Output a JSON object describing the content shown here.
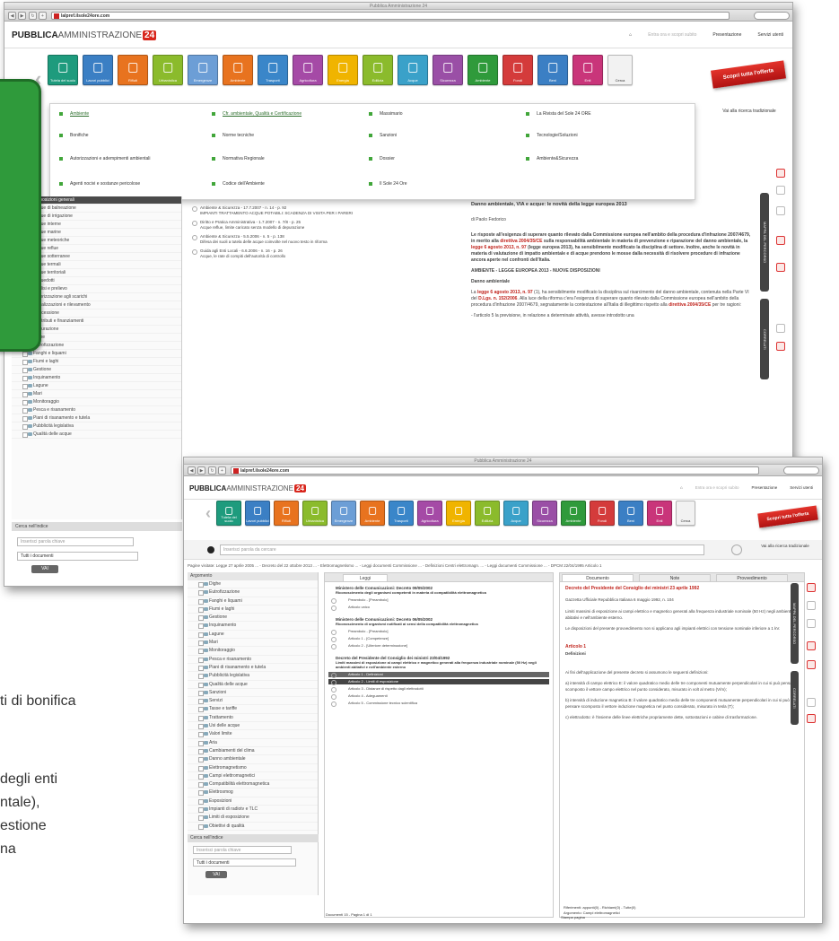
{
  "bg_text": {
    "line1": "ti di bonifica",
    "line2": "degli enti",
    "line3": "ntale),",
    "line4": "estione",
    "line5": "na"
  },
  "back_window": {
    "title": "Pubblica Amministrazione 24",
    "url_domain": "lalpref.ilsole24ore.com",
    "logo_main": "PUBBLICA",
    "logo_thin": "AMMINISTRAZIONE",
    "logo_badge": "24",
    "toplinks": [
      "Presentazione",
      "Servizi utenti"
    ],
    "toplinks_muted": "Entra ora e scopri subito",
    "ribbon": "Scopri tutta l'offerta",
    "tile_colors": [
      "#1e9b7d",
      "#3b7fc4",
      "#e8731f",
      "#8bbb2c",
      "#6c9ed6",
      "#e8731f",
      "#3a86c9",
      "#a54aa6",
      "#f0b400",
      "#8bbb2c",
      "#3aa1c9",
      "#9a4fa6",
      "#2f9a3b",
      "#d43b3b",
      "#3b7fc4",
      "#c9357a"
    ],
    "tile_labels": [
      "Tutela del suolo",
      "Lavori pubblici",
      "Rifiuti",
      "Urbanistica",
      "Emergenze",
      "Ambiente",
      "Trasporti",
      "Agricoltura",
      "Energia",
      "Edilizia",
      "Acque",
      "Sicurezza",
      "Ambiente",
      "Fondi",
      "Beni",
      "Enti"
    ],
    "extra_tile": "Cerca",
    "dropdown": {
      "col1": [
        "Ambiente",
        "Bonifiche",
        "Autorizzazioni e adempimenti ambientali",
        "Agenti nocivi e sostanze pericolose"
      ],
      "col2": [
        "Cfr. ambientale, Qualità e Certificazione",
        "Norme tecniche",
        "Normativa Regionale",
        "Codice dell'Ambiente"
      ],
      "col3": [
        "Massimario",
        "Sanzioni",
        "Dossier",
        "Il Sole 24 Ore"
      ],
      "col4": [
        "La Rivista del Sole 24 ORE",
        "Tecnologie/Soluzioni",
        "Ambiente&Sicurezza"
      ]
    },
    "right_btn": "Vai alla ricerca tradizionale",
    "tree_items": [
      "Acque di balneazione",
      "Acque di irrigazione",
      "Acque interne",
      "Acque marine",
      "Acque meteoriche",
      "Acque reflue",
      "Acque sotterranee",
      "Acque termali",
      "Acque territoriali",
      "Acquedotti",
      "Analisi e prelievo",
      "Autorizzazione agli scarichi",
      "Canalizzazioni e rilevamento",
      "Concessione",
      "Contributi e finanziamenti",
      "Depurazione",
      "Dighe",
      "Eutrofizzazione",
      "Fanghi e liquami",
      "Fiumi e laghi",
      "Gestione",
      "Inquinamento",
      "Lagune",
      "Mari",
      "Monitoraggio",
      "Pesca e risanamento",
      "Piani di risanamento e tutela",
      "Pubblicità legislativa",
      "Qualità delle acque"
    ],
    "tree_header": "Disposizioni generali",
    "filter_label": "Cerca nell'indice",
    "search_placeholder": "Inserisci parola chiave",
    "select_value": "Tutti i documenti",
    "go_btn": "VAI",
    "results": [
      {
        "l1": "Ambiente & Sicurezza - 17.7.2007 - n. 14 - p. 92",
        "l2": "IMPIANTI TRATTAMENTO ACQUE POTABILI: SCADENZA DI VISITA PER I PARERI"
      },
      {
        "l1": "Diritto e Pratica Amministrativa - 1.7.2007 - n. 7/8 - p. 25",
        "l2": "Acque reflue, limite caricato senza modello di depurazione"
      },
      {
        "l1": "Ambiente & Sicurezza - 5.5.2006 - n. 5 - p. 138",
        "l2": "Difesa dei suoli a tutela delle acque coinvolte nel nuovo testo in riforma"
      },
      {
        "l1": "Guida agli Enti Locali - 6.6.2006 - n. 16 - p. 26",
        "l2": "Acque, le rate di compiti dell'autorità di controllo"
      }
    ],
    "doc": {
      "title": "Danno ambientale, VIA e acque: le novità della legge europea 2013",
      "author": "di Paolo Fedorico",
      "lead_1": "Le risposte all'esigenza di superare quanto rilevato dalla Commissione europea nell'ambito della procedura d'infrazione 2007/4679, in merito alla",
      "lead_red1": "direttiva 2004/35/CE",
      "lead_2": "sulla responsabilità ambientale in materia di prevenzione e riparazione del danno ambientale, la",
      "lead_red2": "legge 6 agosto 2013, n. 97",
      "lead_3": "(legge europea 2013), ha sensibilmente modificato la disciplina di settore. Inoltre, anche le novità in materia di valutazione di impatto ambientale e di acque prendono le mosse dalla necessità di risolvere procedure di infrazione ancora aperte nel confronti dell'Italia.",
      "section": "AMBIENTE - LEGGE EUROPEA 2013 - NUOVE DISPOSIZIONI",
      "sub": "Danno ambientale",
      "body_1": "La",
      "body_red1": "legge 6 agosto 2013, n. 97",
      "body_2": "(1), ha sensibilmente modificato la disciplina sul risarcimento del danno ambientale, contenuta nella Parte VI del",
      "body_red2": "D.Lgs. n. 152/2006",
      "body_3": ". Alla luce della riforma c'era l'esigenza di superare quanto rilevato dalla Commissione europea nell'ambito della procedura d'infrazione 2007/4679, segnatamente la contestazione all'Italia di illegittimo rispetto alla",
      "body_red3": "direttiva 2004/35/CE",
      "body_4": "per tre ragioni:",
      "body_5": "- l'articolo 5 la previsione, in relazione a determinate attività, avesse introdotto una"
    },
    "strip1": "MAPPA DEL PERCORSO",
    "strip2": "CORRELATI"
  },
  "front_window": {
    "title": "Pubblica Amministrazione 24",
    "url_domain": "lalpref.ilsole24ore.com",
    "logo_main": "PUBBLICA",
    "logo_thin": "AMMINISTRAZIONE",
    "logo_badge": "24",
    "toplinks": [
      "Presentazione",
      "Servizi utenti"
    ],
    "toplinks_muted": "Entra ora e scopri subito",
    "ribbon": "Scopri tutta l'offerta",
    "search_placeholder": "Inserisci parola da cercare",
    "right_btn": "Vai alla ricerca tradizionale",
    "breadcrumb": "Pagine visitate: Legge 27 aprile 2005 ... - Decreto del 22 ottobre 2013 ... - Elettromagnetismo ... - Leggi documenti Commissione ... - Definizioni Centri elettromagn. ... - Leggi documenti Commissione ... - DPCM 22/04/1995 Articolo 1",
    "left_header": "Argomento",
    "tree_items": [
      "Dighe",
      "Eutrofizzazione",
      "Fanghi e liquami",
      "Fiumi e laghi",
      "Gestione",
      "Inquinamento",
      "Lagune",
      "Mari",
      "Monitoraggio",
      "Pesca e risanamento",
      "Piani di risanamento e tutela",
      "Pubblicità legislativa",
      "Qualità delle acque",
      "Sanzioni",
      "Servizi",
      "Tasse e tariffe",
      "Trattamento",
      "Usi delle acque",
      "Valori limite",
      "Aria",
      "Cambiamenti del clima",
      "Danno ambientale",
      "Elettromagnetismo",
      "Campi elettromagnetici",
      "Compatibilità elettromagnetica",
      "Elettrosmog",
      "Esposizioni",
      "Impianti di radiotv e TLC",
      "Limiti di esposizione",
      "Obiettivi di qualità"
    ],
    "filter_label": "Cerca nell'indice",
    "search_tree_placeholder": "Inserisci parola chiave",
    "select_value": "Tutti i documenti",
    "go_btn": "VAI",
    "mid_tab": "Leggi",
    "mid_docs": [
      {
        "title": "Ministero delle Comunicazioni: Decreto 09/05/2002",
        "sub": "Riconoscimento degli organismi competenti in materia di compatibilità elettromagnetica",
        "children": [
          "Preambolo - [Preambolo]",
          "Articolo unico"
        ]
      },
      {
        "title": "Ministero delle Comunicazioni: Decreto 06/05/2002",
        "sub": "Riconoscimento di organismi notificati ai sensi della compatibilità elettromagnetica",
        "children": [
          "Preambolo - [Preambolo]",
          "Articolo 1 - [Competenze]",
          "Articolo 2 - [Ulteriore determinazione]"
        ]
      },
      {
        "title": "Decreto del Presidente del Consiglio dei ministri 23/04/1992",
        "sub": "Limiti massimi di esposizione ai campi elettrico e magnetico generati alla frequenza industriale nominale (50 Hz) negli ambienti abitativi e nell'ambiente esterno",
        "children": [
          "Articolo 1 - Definizioni",
          "Articolo 2 - Limiti di esposizione",
          "Articolo 3 - Distanze di rispetto dagli elettrodotti",
          "Articolo 4 - Adeguamenti",
          "Articolo 5 - Commissione tecnico scientifica"
        ]
      }
    ],
    "doc_tabs": [
      "Documento",
      "Note",
      "Provvedimento"
    ],
    "doc": {
      "title": "Decreto del Presidente del Consiglio dei ministri 23 aprile 1992",
      "sub": "Gazzetta Ufficiale Repubblica Italiana 6 maggio 1992, n. 104",
      "p1": "Limiti massimi di esposizione ai campi elettrico e magnetico generati alla frequenza industriale nominale (50 Hz) negli ambienti abitativi e nell'ambiente esterno.",
      "p2": "Le disposizioni del presente provvedimento non si applicano agli impianti elettrici con tensione nominale inferiore a 1 kV.",
      "art": "Articolo 1",
      "art_sub": "Definizioni",
      "p3": "Ai fini dell'applicazione del presente decreto si assumono le seguenti definizioni:",
      "p4": "a) intensità di campo elettrico E: il valore quadratico medio delle tre componenti mutuamente perpendicolari in cui si può pensare scomposto il vettore campo elettrico nel punto considerato, misurato in volt al metro (V/m);",
      "p5": "b) intensità di induzione magnetica B: il valore quadratico medio delle tre componenti mutuamente perpendicolari in cui si può pensare scomposto il vettore induzione magnetica nel punto considerato, misurato in tesla (T);",
      "p6": "c) elettrodotto: è l'insieme delle linee elettriche propriamente dette, sottostazioni e cabine di trasformazione."
    },
    "footer_left": "Documenti 15 - Pagina 1 di 1",
    "footer_right": "Riferimenti: appunti(0) - Richiami(0) - Tutte(0)",
    "footer_right2": "Argomento: Campi elettromagnetici",
    "footer_print": "Stampa pagina",
    "strip1": "MAPPA DEL PERCORSO",
    "strip2": "CORRELATI"
  }
}
